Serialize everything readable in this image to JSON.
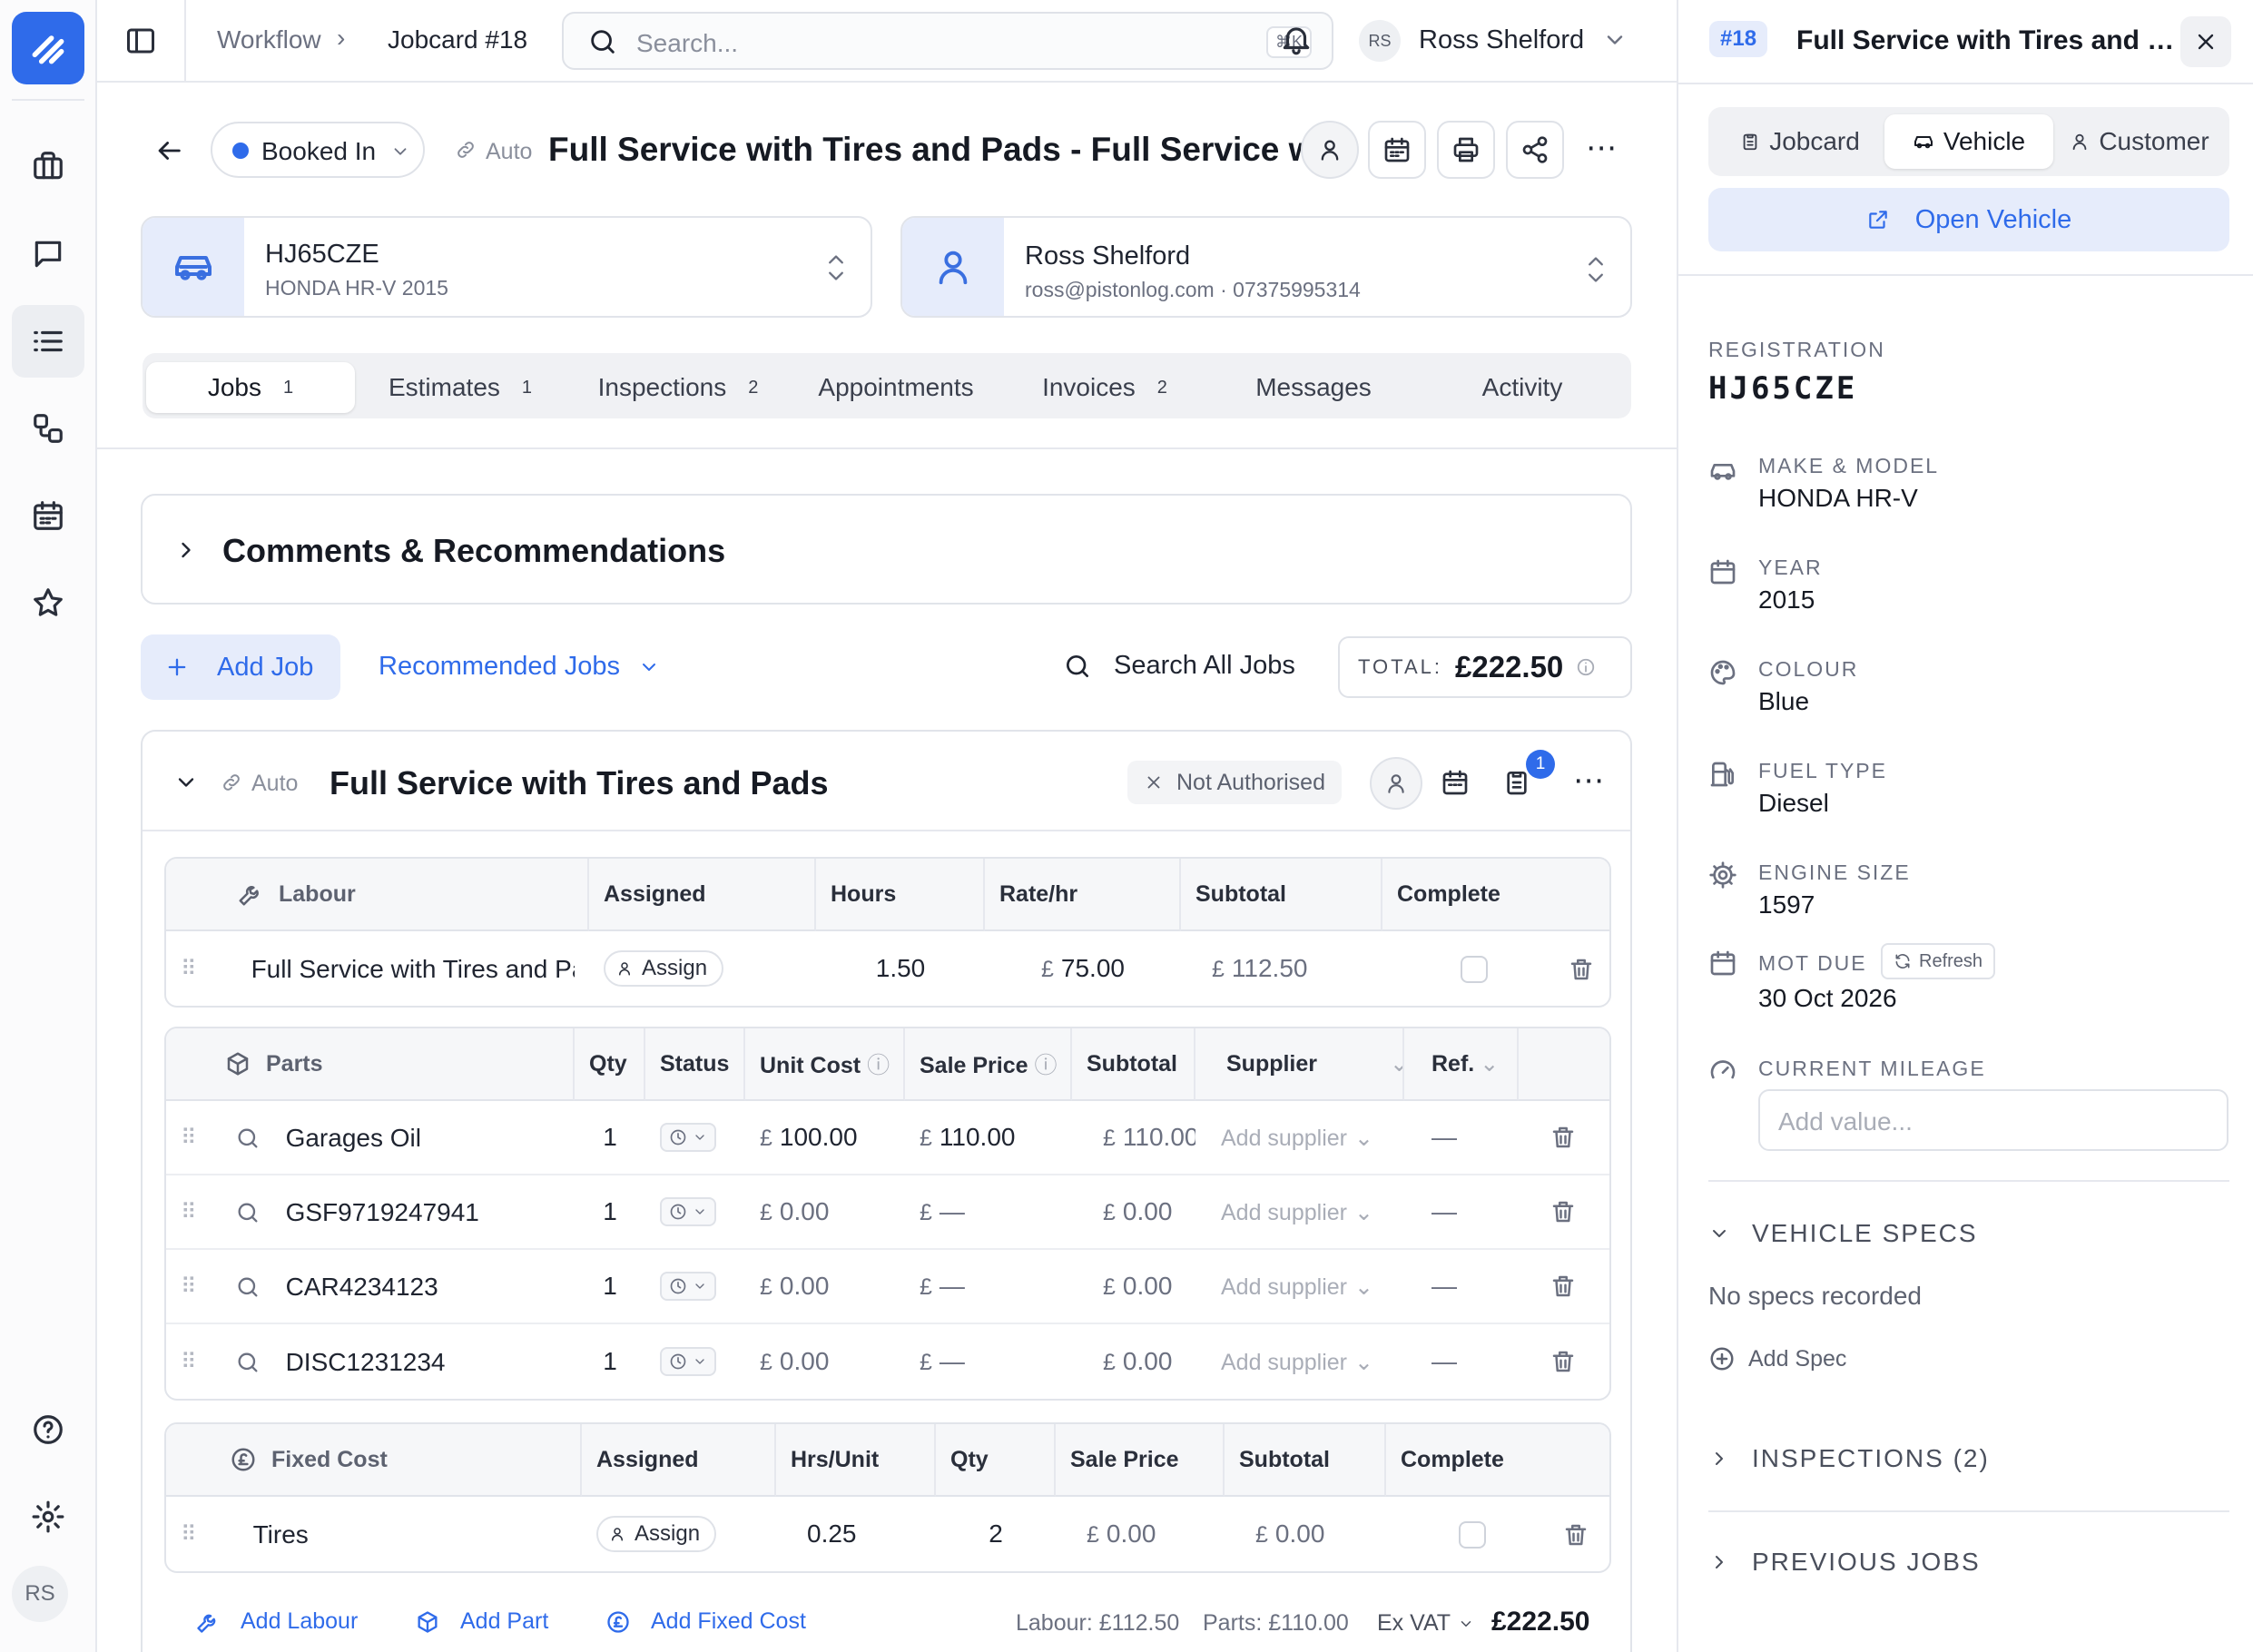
{
  "app": {
    "brand_color": "#2f6bea",
    "user_initials": "RS"
  },
  "rail": {
    "items": [
      {
        "icon": "briefcase-icon"
      },
      {
        "icon": "chat-icon"
      },
      {
        "icon": "list-icon"
      },
      {
        "icon": "workflow-icon"
      },
      {
        "icon": "calendar-icon"
      },
      {
        "icon": "star-icon"
      }
    ],
    "bottom": [
      {
        "icon": "help-icon"
      },
      {
        "icon": "gear-icon"
      }
    ]
  },
  "topbar": {
    "breadcrumb": [
      "Workflow",
      "Jobcard #18"
    ],
    "search_placeholder": "Search...",
    "search_shortcut": "⌘K",
    "user_initials": "RS",
    "user_name": "Ross Shelford"
  },
  "jobcard": {
    "status": "Booked In",
    "status_color": "#2f6bea",
    "auto_label": "Auto",
    "title": "Full Service with Tires and Pads - Full Service w...",
    "vehicle": {
      "registration": "HJ65CZE",
      "description": "HONDA HR-V 2015"
    },
    "customer": {
      "name": "Ross Shelford",
      "contact": "ross@pistonlog.com · 07375995314"
    },
    "tabs": [
      {
        "label": "Jobs",
        "count": "1"
      },
      {
        "label": "Estimates",
        "count": "1"
      },
      {
        "label": "Inspections",
        "count": "2"
      },
      {
        "label": "Appointments",
        "count": ""
      },
      {
        "label": "Invoices",
        "count": "2"
      },
      {
        "label": "Messages",
        "count": ""
      },
      {
        "label": "Activity",
        "count": ""
      }
    ],
    "active_tab": "Jobs"
  },
  "comments": {
    "title": "Comments & Recommendations"
  },
  "actions": {
    "add_job": "Add Job",
    "recommended": "Recommended Jobs",
    "search_all": "Search All Jobs",
    "total_label": "TOTAL:",
    "total_value": "£222.50"
  },
  "job": {
    "auto_label": "Auto",
    "title": "Full Service with Tires and Pads",
    "auth_status": "Not Authorised",
    "notification_count": "1",
    "labour": {
      "headers": [
        "Labour",
        "Assigned",
        "Hours",
        "Rate/hr",
        "Subtotal",
        "Complete"
      ],
      "rows": [
        {
          "name": "Full Service with Tires and Pads",
          "assign": "Assign",
          "hours": "1.50",
          "rate": "75.00",
          "subtotal": "112.50"
        }
      ]
    },
    "parts": {
      "headers": [
        "Parts",
        "Qty",
        "Status",
        "Unit Cost",
        "Sale Price",
        "Subtotal",
        "Supplier",
        "Ref."
      ],
      "rows": [
        {
          "name": "Garages Oil",
          "qty": "1",
          "unit": "100.00",
          "sale": "110.00",
          "subtotal": "110.00",
          "supplier": "Add supplier",
          "ref": "—"
        },
        {
          "name": "GSF9719247941",
          "qty": "1",
          "unit": "0.00",
          "sale": "—",
          "subtotal": "0.00",
          "supplier": "Add supplier",
          "ref": "—"
        },
        {
          "name": "CAR4234123",
          "qty": "1",
          "unit": "0.00",
          "sale": "—",
          "subtotal": "0.00",
          "supplier": "Add supplier",
          "ref": "—"
        },
        {
          "name": "DISC1231234",
          "qty": "1",
          "unit": "0.00",
          "sale": "—",
          "subtotal": "0.00",
          "supplier": "Add supplier",
          "ref": "—"
        }
      ]
    },
    "fixed": {
      "headers": [
        "Fixed Cost",
        "Assigned",
        "Hrs/Unit",
        "Qty",
        "Sale Price",
        "Subtotal",
        "Complete"
      ],
      "rows": [
        {
          "name": "Tires",
          "assign": "Assign",
          "hrs": "0.25",
          "qty": "2",
          "sale": "0.00",
          "subtotal": "0.00"
        }
      ]
    },
    "footer": {
      "add_labour": "Add Labour",
      "add_part": "Add Part",
      "add_fixed": "Add Fixed Cost",
      "labour_total": "Labour: £112.50",
      "parts_total": "Parts: £110.00",
      "vat_mode": "Ex VAT",
      "grand_total": "£222.50"
    },
    "currency": "£"
  },
  "panel": {
    "badge": "#18",
    "title": "Full Service with Tires and Pads",
    "tabs": [
      "Jobcard",
      "Vehicle",
      "Customer"
    ],
    "active_tab": "Vehicle",
    "open_vehicle": "Open Vehicle",
    "registration_label": "REGISTRATION",
    "registration": "HJ65CZE",
    "fields": [
      {
        "label": "MAKE & MODEL",
        "value": "HONDA HR-V",
        "icon": "car-icon"
      },
      {
        "label": "YEAR",
        "value": "2015",
        "icon": "calendar-icon"
      },
      {
        "label": "COLOUR",
        "value": "Blue",
        "icon": "palette-icon"
      },
      {
        "label": "FUEL TYPE",
        "value": "Diesel",
        "icon": "fuel-icon"
      },
      {
        "label": "ENGINE SIZE",
        "value": "1597",
        "icon": "engine-icon"
      },
      {
        "label": "MOT DUE",
        "value": "30 Oct 2026",
        "icon": "calendar-icon"
      }
    ],
    "refresh": "Refresh",
    "mileage_label": "CURRENT MILEAGE",
    "mileage_placeholder": "Add value...",
    "specs_title": "VEHICLE SPECS",
    "specs_empty": "No specs recorded",
    "add_spec": "Add Spec",
    "inspections": "INSPECTIONS (2)",
    "previous_jobs": "PREVIOUS JOBS"
  }
}
